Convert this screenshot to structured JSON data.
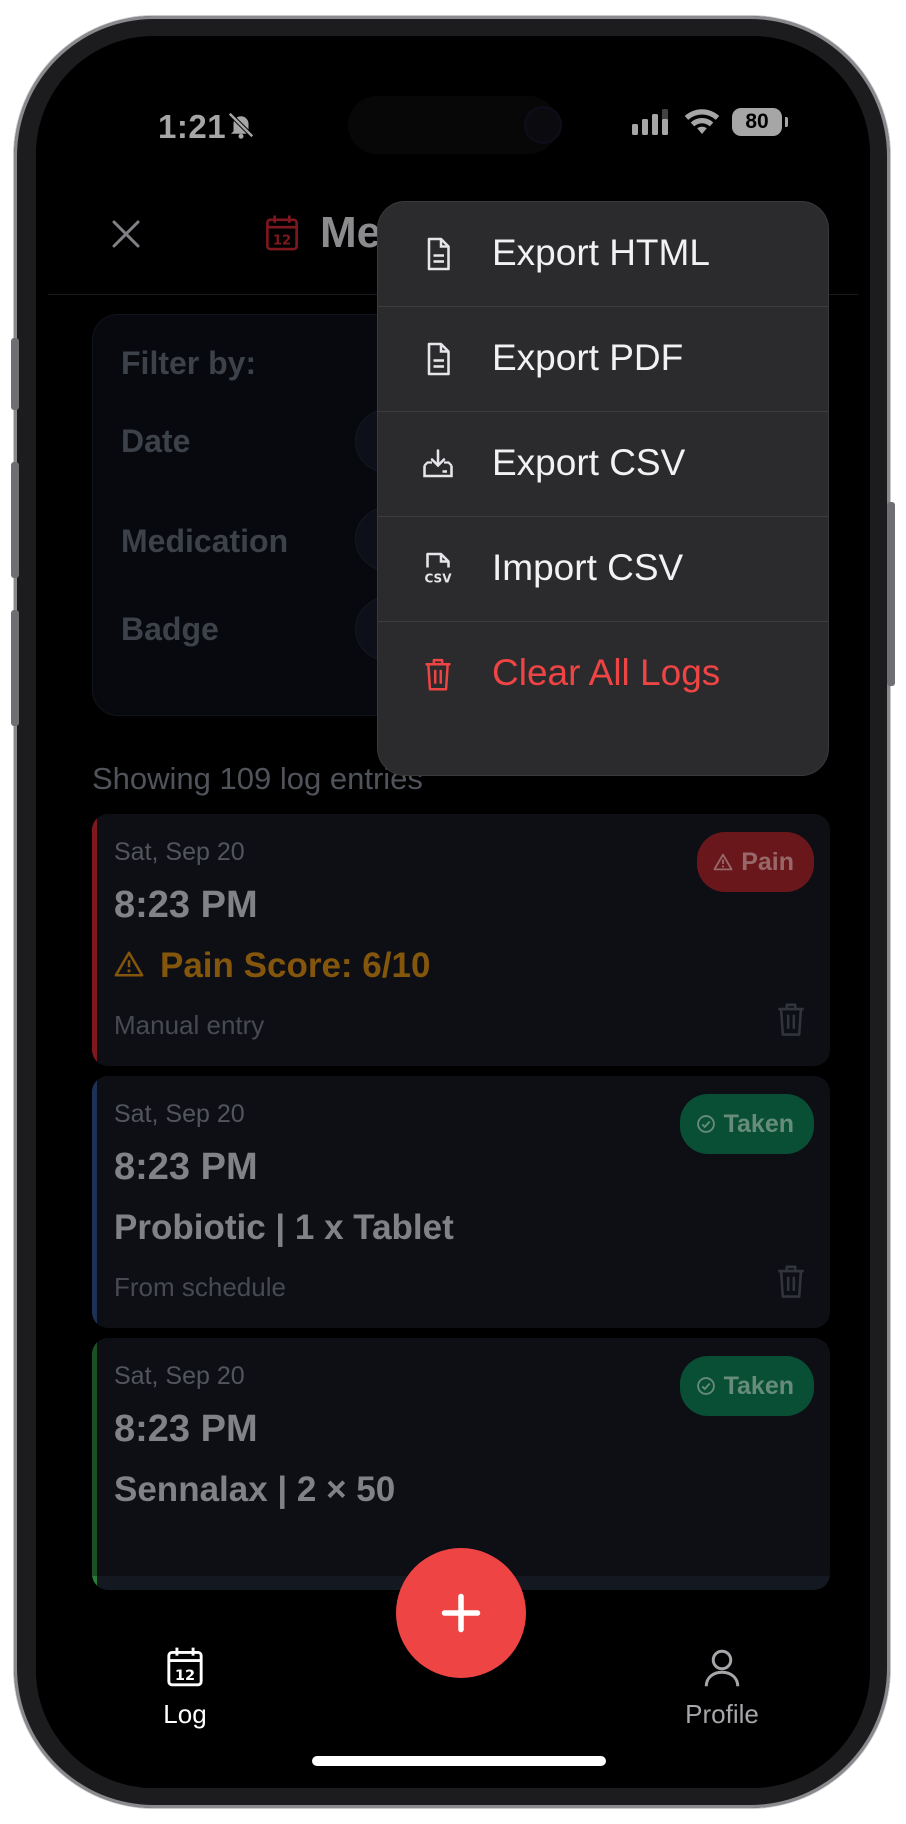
{
  "status_bar": {
    "time": "1:21",
    "battery": "80"
  },
  "header": {
    "title": "Me",
    "close_icon": "close-icon",
    "calendar_icon": "calendar-icon"
  },
  "filter": {
    "title": "Filter by:",
    "date_label": "Date",
    "medication_label": "Medication",
    "badge_label": "Badge"
  },
  "menu": {
    "items": [
      {
        "label": "Export HTML",
        "icon": "file-icon"
      },
      {
        "label": "Export PDF",
        "icon": "file-icon"
      },
      {
        "label": "Export CSV",
        "icon": "download-tray-icon"
      },
      {
        "label": "Import CSV",
        "icon": "csv-file-icon"
      },
      {
        "label": "Clear All Logs",
        "icon": "trash-icon",
        "color": "#ef4444"
      }
    ]
  },
  "summary": {
    "showing": "Showing 109 log entries"
  },
  "logs": [
    {
      "date": "Sat, Sep 20",
      "time": "8:23 PM",
      "main": "Pain Score: 6/10",
      "source": "Manual entry",
      "badge": "Pain",
      "accent": "#c2262e"
    },
    {
      "date": "Sat, Sep 20",
      "time": "8:23 PM",
      "main": "Probiotic | 1 x Tablet",
      "source": "From schedule",
      "badge": "Taken",
      "accent": "#2d4a86"
    },
    {
      "date": "Sat, Sep 20",
      "time": "8:23 PM",
      "main": "Sennalax | 2 × 50",
      "source": "",
      "badge": "Taken",
      "accent": "#2a7a3a"
    }
  ],
  "tabbar": {
    "log_label": "Log",
    "profile_label": "Profile",
    "fab_label": "+"
  },
  "colors": {
    "accent": "#ef4444",
    "taken": "#0f7a52",
    "pain": "#a4242a",
    "warning": "#c98512"
  }
}
